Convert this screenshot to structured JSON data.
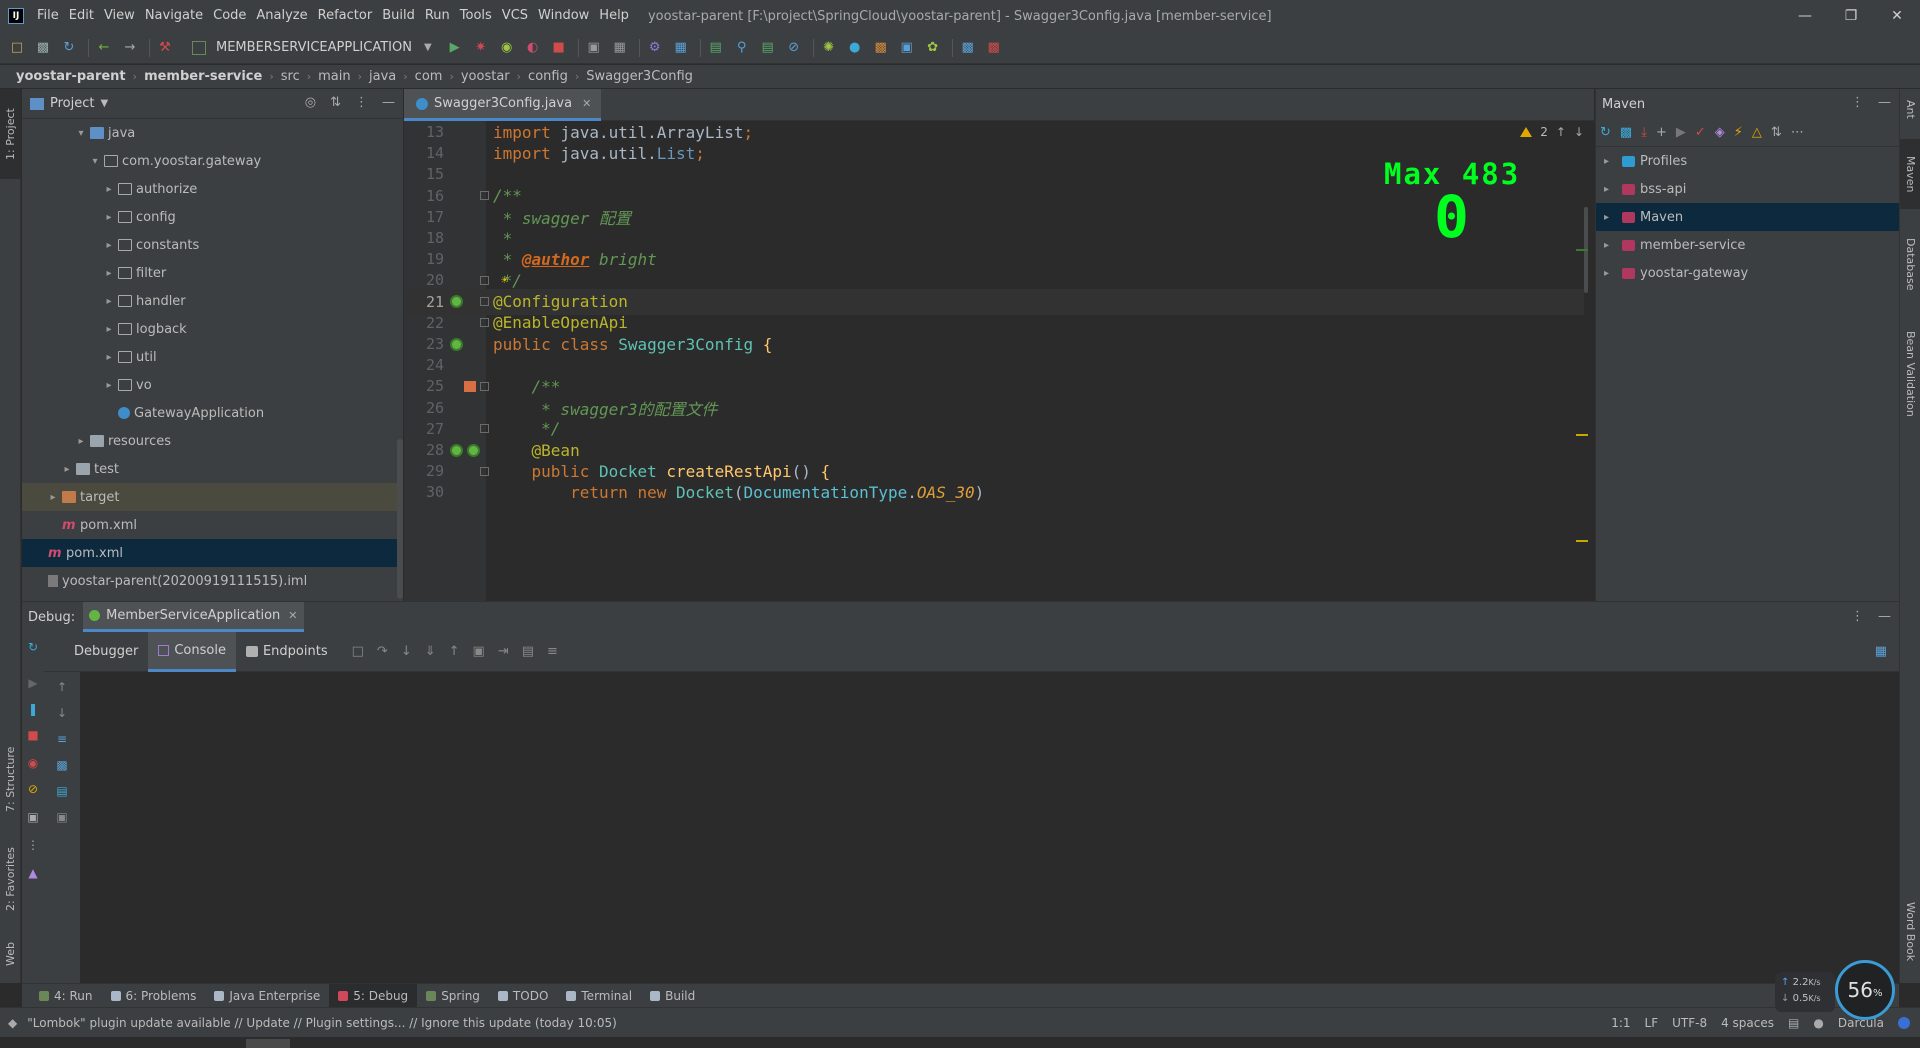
{
  "window": {
    "title": "yoostar-parent [F:\\project\\SpringCloud\\yoostar-parent] - Swagger3Config.java [member-service]",
    "logo": "IJ"
  },
  "menu": [
    "File",
    "Edit",
    "View",
    "Navigate",
    "Code",
    "Analyze",
    "Refactor",
    "Build",
    "Run",
    "Tools",
    "VCS",
    "Window",
    "Help"
  ],
  "toolbar": {
    "run_config": "MEMBERSERVICEAPPLICATION"
  },
  "breadcrumb": [
    "yoostar-parent",
    "member-service",
    "src",
    "main",
    "java",
    "com",
    "yoostar",
    "config",
    "Swagger3Config"
  ],
  "left_stripe": {
    "project_tab": "1: Project",
    "structure_tab": "7: Structure",
    "favorites_tab": "2: Favorites",
    "web_tab": "Web"
  },
  "right_stripe": {
    "ant_tab": "Ant",
    "maven_tab": "Maven",
    "database_tab": "Database",
    "bean_validation_tab": "Bean Validation",
    "word_book_tab": "Word Book"
  },
  "project_panel": {
    "title": "Project",
    "tree": [
      {
        "label": "java",
        "depth": 4,
        "expanded": true,
        "icon": "folder-blue"
      },
      {
        "label": "com.yoostar.gateway",
        "depth": 5,
        "expanded": true,
        "icon": "folder"
      },
      {
        "label": "authorize",
        "depth": 6,
        "icon": "folder"
      },
      {
        "label": "config",
        "depth": 6,
        "icon": "folder"
      },
      {
        "label": "constants",
        "depth": 6,
        "icon": "folder"
      },
      {
        "label": "filter",
        "depth": 6,
        "icon": "folder"
      },
      {
        "label": "handler",
        "depth": 6,
        "icon": "folder"
      },
      {
        "label": "logback",
        "depth": 6,
        "icon": "folder"
      },
      {
        "label": "util",
        "depth": 6,
        "icon": "folder"
      },
      {
        "label": "vo",
        "depth": 6,
        "icon": "folder"
      },
      {
        "label": "GatewayApplication",
        "depth": 6,
        "leaf": true,
        "icon": "class"
      },
      {
        "label": "resources",
        "depth": 4,
        "icon": "folder-plain"
      },
      {
        "label": "test",
        "depth": 3,
        "icon": "folder-plain"
      },
      {
        "label": "target",
        "depth": 2,
        "icon": "folder-target",
        "highlight": true
      },
      {
        "label": "pom.xml",
        "depth": 2,
        "leaf": true,
        "icon": "mvn"
      },
      {
        "label": "pom.xml",
        "depth": 1,
        "leaf": true,
        "icon": "mvn",
        "selected": true
      },
      {
        "label": "yoostar-parent(20200919111515).iml",
        "depth": 1,
        "leaf": true,
        "icon": "iml"
      }
    ]
  },
  "editor": {
    "tab_label": "Swagger3Config.java",
    "warning_count": "2",
    "overlay_max": "Max 483",
    "overlay_zero": "0",
    "current_line": "21",
    "line_numbers": [
      "13",
      "14",
      "15",
      "16",
      "17",
      "18",
      "19",
      "20",
      "21",
      "22",
      "23",
      "24",
      "25",
      "26",
      "27",
      "28",
      "29",
      "30"
    ]
  },
  "maven_panel": {
    "title": "Maven",
    "items": [
      {
        "label": "Profiles",
        "icon": "prof"
      },
      {
        "label": "bss-api",
        "icon": "mod"
      },
      {
        "label": "Maven",
        "icon": "mod",
        "selected": true
      },
      {
        "label": "member-service",
        "icon": "mod"
      },
      {
        "label": "yoostar-gateway",
        "icon": "mod"
      }
    ]
  },
  "debug": {
    "label": "Debug:",
    "session_tab": "MemberServiceApplication",
    "subtabs": [
      "Debugger",
      "Console",
      "Endpoints"
    ],
    "active_subtab": "Console"
  },
  "bottom_tools": [
    {
      "label": "4: Run",
      "icon_color": "#6a8759"
    },
    {
      "label": "6: Problems",
      "icon_color": "#a9b7c6"
    },
    {
      "label": "Java Enterprise",
      "icon_color": "#a9b7c6"
    },
    {
      "label": "5: Debug",
      "icon_color": "#d0485a",
      "active": true
    },
    {
      "label": "Spring",
      "icon_color": "#6a8759"
    },
    {
      "label": "TODO",
      "icon_color": "#a9b7c6"
    },
    {
      "label": "Terminal",
      "icon_color": "#a9b7c6"
    },
    {
      "label": "Build",
      "icon_color": "#a9b7c6"
    }
  ],
  "status": {
    "message": "\"Lombok\" plugin update available // Update // Plugin settings... // Ignore this update (today 10:05)",
    "position": "1:1",
    "line_sep": "LF",
    "encoding": "UTF-8",
    "indent": "4 spaces",
    "theme": "Darcula"
  },
  "net_widget": {
    "upload": "2.2",
    "upload_unit": "K/s",
    "download": "0.5",
    "download_unit": "K/s",
    "cpu": "56",
    "cpu_unit": "%"
  },
  "colors": {
    "accent": "#4a88c7",
    "selection": "#0d293e",
    "overlay_green": "#00ff1e"
  }
}
